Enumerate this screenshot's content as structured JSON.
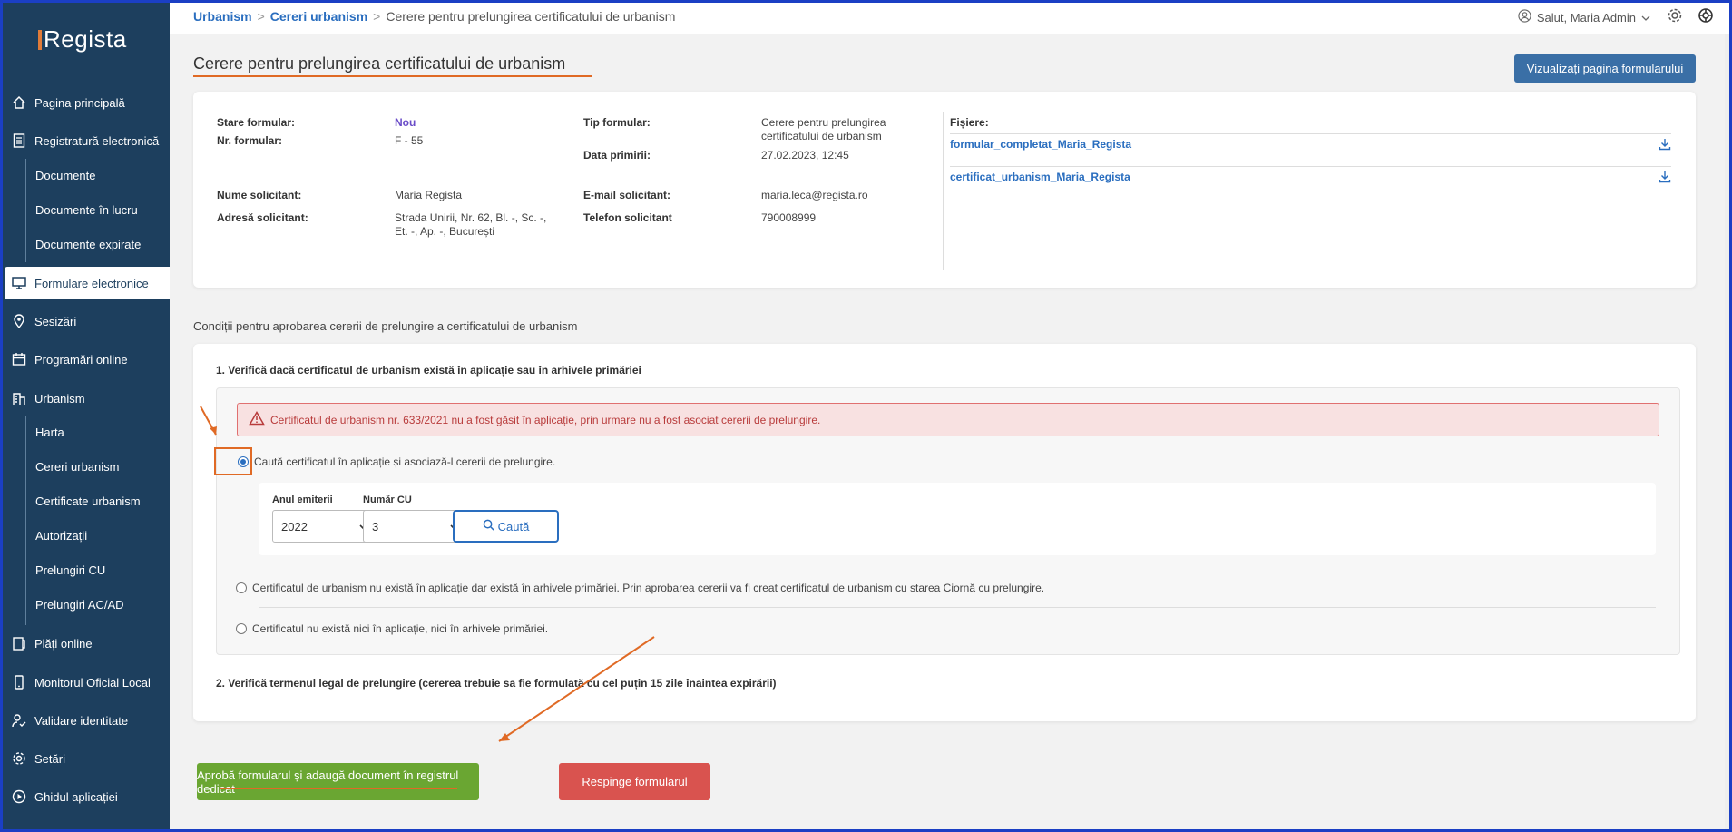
{
  "app": {
    "logo": "Regista"
  },
  "sidebar": {
    "items": [
      {
        "label": "Pagina principală",
        "icon": "home-icon"
      },
      {
        "label": "Registratură electronică",
        "icon": "document-icon"
      },
      {
        "label": "Formulare electronice",
        "icon": "monitor-icon"
      },
      {
        "label": "Sesizări",
        "icon": "map-pin-icon"
      },
      {
        "label": "Programări online",
        "icon": "calendar-icon"
      },
      {
        "label": "Urbanism",
        "icon": "building-icon"
      },
      {
        "label": "Plăți online",
        "icon": "payment-icon"
      },
      {
        "label": "Monitorul Oficial Local",
        "icon": "mobile-icon"
      },
      {
        "label": "Validare identitate",
        "icon": "user-check-icon"
      },
      {
        "label": "Setări",
        "icon": "gear-icon"
      },
      {
        "label": "Ghidul aplicației",
        "icon": "play-circle-icon"
      }
    ],
    "registratura_sub": [
      "Documente",
      "Documente în lucru",
      "Documente expirate"
    ],
    "urbanism_sub": [
      "Harta",
      "Cereri urbanism",
      "Certificate urbanism",
      "Autorizații",
      "Prelungiri CU",
      "Prelungiri AC/AD"
    ]
  },
  "breadcrumb": {
    "items": [
      "Urbanism",
      "Cereri urbanism"
    ],
    "current": "Cerere pentru prelungirea certificatului de urbanism"
  },
  "user": {
    "greeting": "Salut, Maria Admin"
  },
  "page": {
    "title": "Cerere pentru prelungirea certificatului de urbanism",
    "view_button": "Vizualizați pagina formularului"
  },
  "form_info": {
    "stare_label": "Stare formular:",
    "stare_value": "Nou",
    "nr_label": "Nr. formular:",
    "nr_value": "F - 55",
    "tip_label": "Tip formular:",
    "tip_value_1": "Cerere pentru prelungirea",
    "tip_value_2": "certificatului de urbanism",
    "data_label": "Data primirii:",
    "data_value": "27.02.2023, 12:45",
    "nume_label": "Nume solicitant:",
    "nume_value": "Maria Regista",
    "adresa_label": "Adresă solicitant:",
    "adresa_value_1": "Strada Unirii, Nr. 62, Bl. -, Sc. -,",
    "adresa_value_2": "Et. -, Ap. -, București",
    "email_label": "E-mail solicitant:",
    "email_value": "maria.leca@regista.ro",
    "telefon_label": "Telefon solicitant",
    "telefon_value": "790008999",
    "files_label": "Fișiere:",
    "files": [
      "formular_completat_Maria_Regista",
      "certificat_urbanism_Maria_Regista"
    ]
  },
  "conditions": {
    "title": "Condiții pentru aprobarea cererii de prelungire a certificatului de urbanism",
    "step1": "1. Verifică dacă certificatul de urbanism există în aplicație sau în arhivele primăriei",
    "alert": "Certificatul de urbanism nr. 633/2021 nu a fost găsit în aplicație, prin urmare nu a fost asociat cererii de prelungire.",
    "option1": "Caută certificatul în aplicație și asociază-l cererii de prelungire.",
    "anul_label": "Anul emiterii",
    "anul_value": "2022",
    "numar_label": "Număr CU",
    "numar_value": "3",
    "search_button": "Caută",
    "option2": "Certificatul de urbanism nu există în aplicație dar există în arhivele primăriei. Prin aprobarea cererii va fi creat certificatul de urbanism cu starea Ciornă cu prelungire.",
    "option3": "Certificatul nu există nici în aplicație, nici în arhivele primăriei.",
    "step2": "2. Verifică termenul legal de prelungire (cererea trebuie sa fie formulată cu cel puțin 15 zile înaintea expirării)"
  },
  "actions": {
    "approve": "Aprobă formularul și adaugă document în registrul dedicat",
    "reject": "Respinge formularul"
  },
  "colors": {
    "sidebar": "#1d3f5e",
    "accent": "#2a6ebf",
    "annotation": "#e06a25",
    "approve": "#6aa632",
    "reject": "#d9534f"
  }
}
